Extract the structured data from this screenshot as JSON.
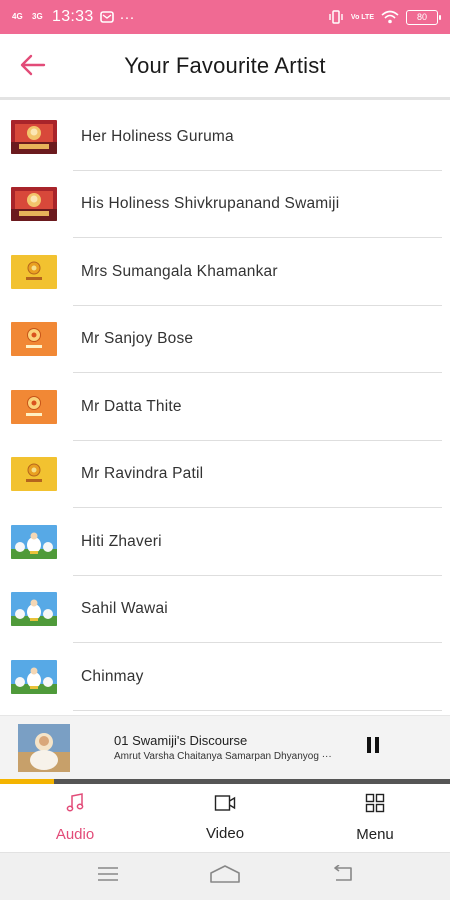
{
  "status_bar": {
    "network_1": "4G",
    "network_2": "3G",
    "time": "13:33",
    "dots": "···",
    "volte": "Vo LTE",
    "battery": "80",
    "background": "#f06a93"
  },
  "header": {
    "title": "Your Favourite Artist",
    "back_icon": "arrow-left-icon",
    "accent": "#e24b78"
  },
  "artists": [
    {
      "name": "Her Holiness Guruma",
      "thumb": "red-stage"
    },
    {
      "name": "His Holiness Shivkrupanand Swamiji",
      "thumb": "red-stage"
    },
    {
      "name": "Mrs Sumangala Khamankar",
      "thumb": "yellow-logo"
    },
    {
      "name": "Mr Sanjoy Bose",
      "thumb": "orange-logo"
    },
    {
      "name": "Mr Datta Thite",
      "thumb": "orange-logo"
    },
    {
      "name": "Mr Ravindra Patil",
      "thumb": "yellow-logo"
    },
    {
      "name": "Hiti Zhaveri",
      "thumb": "sky-cartoon"
    },
    {
      "name": "Sahil Wawai",
      "thumb": "sky-cartoon"
    },
    {
      "name": "Chinmay",
      "thumb": "sky-cartoon"
    }
  ],
  "mini_player": {
    "title": "01 Swamiji's Discourse",
    "subtitle": "Amrut Varsha Chaitanya Samarpan Dhyanyog ···",
    "pause_icon": "pause-icon",
    "progress": 0.12
  },
  "bottom_nav": {
    "items": [
      {
        "label": "Audio",
        "icon": "music-note-icon",
        "active": true
      },
      {
        "label": "Video",
        "icon": "video-icon",
        "active": false
      },
      {
        "label": "Menu",
        "icon": "grid-icon",
        "active": false
      }
    ]
  }
}
